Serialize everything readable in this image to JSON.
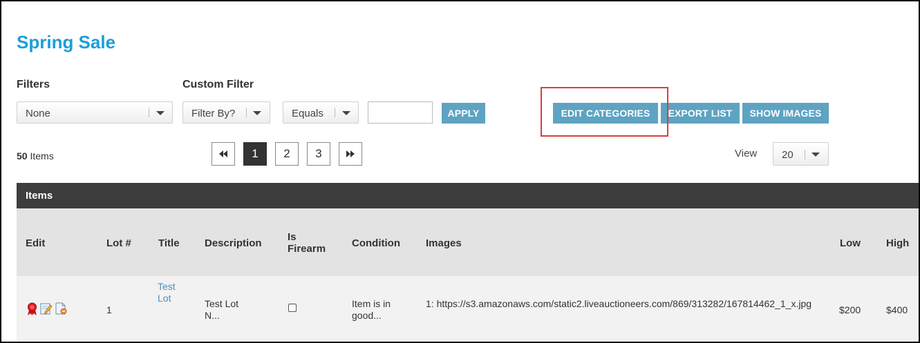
{
  "page": {
    "title": "Spring Sale"
  },
  "filters": {
    "label": "Filters",
    "selected": "None",
    "custom_label": "Custom Filter",
    "filter_by": "Filter By?",
    "operator": "Equals",
    "value": "",
    "apply_label": "APPLY"
  },
  "toolbar": {
    "edit_categories": "EDIT CATEGORIES",
    "export_list": "EXPORT LIST",
    "show_images": "SHOW IMAGES"
  },
  "summary": {
    "count": "50",
    "count_suffix": " Items"
  },
  "pagination": {
    "first_icon": "double-chevron-left-icon",
    "pages": [
      "1",
      "2",
      "3"
    ],
    "current": "1",
    "last_icon": "double-chevron-right-icon"
  },
  "view": {
    "label": "View",
    "value": "20"
  },
  "table": {
    "title": "Items",
    "columns": [
      "Edit",
      "Lot #",
      "Title",
      "Description",
      "Is Firearm",
      "Condition",
      "Images",
      "Low",
      "High"
    ],
    "rows": [
      {
        "edit_icons": [
          "award-ribbon-icon",
          "edit-icon",
          "document-remove-icon"
        ],
        "lot": "1",
        "title": "Test Lot",
        "description": "Test Lot N...",
        "is_firearm": false,
        "condition": "Item is in good...",
        "images": "1: https://s3.amazonaws.com/static2.liveauctioneers.com/869/313282/167814462_1_x.jpg",
        "low": "$200",
        "high": "$400"
      }
    ]
  },
  "colors": {
    "accent": "#1a9fd8",
    "button": "#5ea3c2",
    "highlight": "#e03a3a",
    "table_header": "#3d3d3d"
  }
}
